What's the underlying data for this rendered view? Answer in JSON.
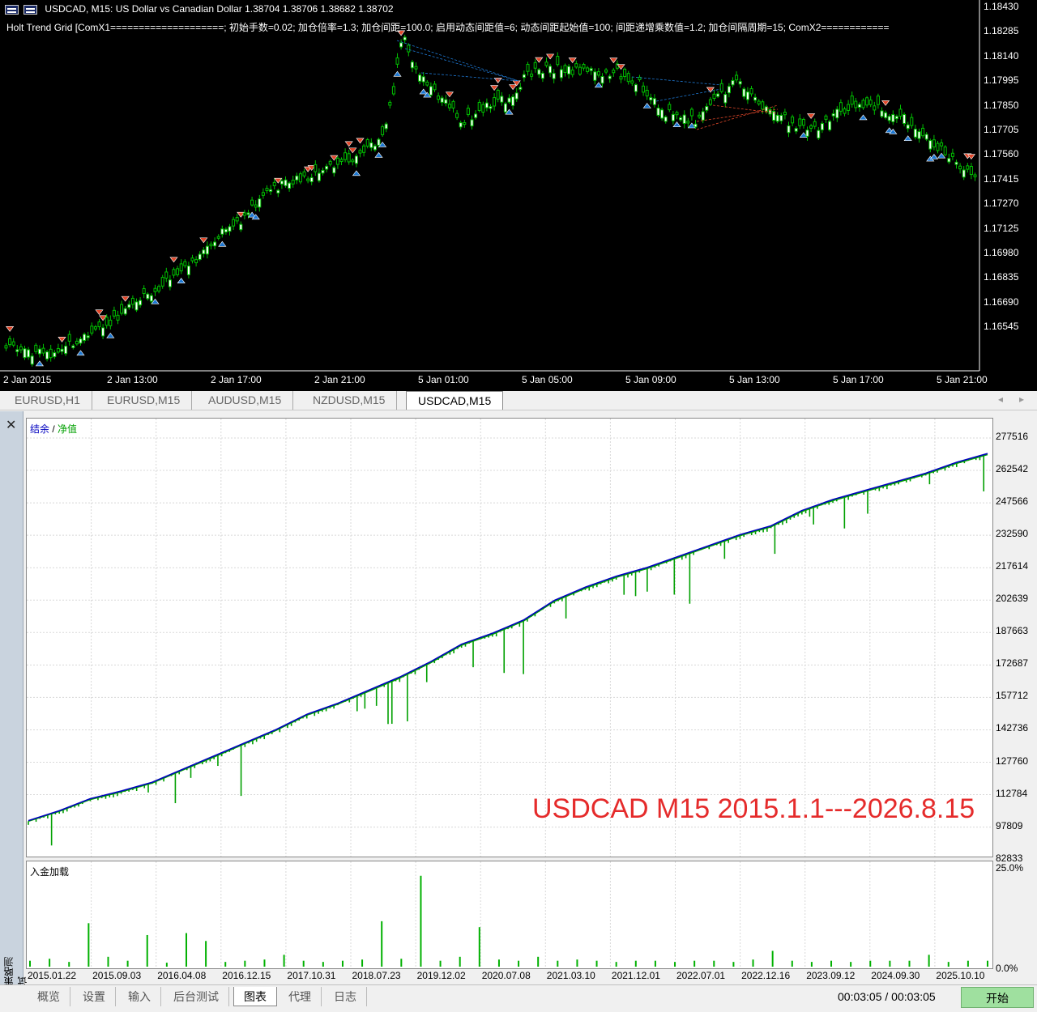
{
  "price_chart": {
    "header": {
      "symbol_line": "USDCAD, M15:  US Dollar vs Canadian Dollar  1.38704 1.38706 1.38682 1.38702",
      "indicator_line": "Holt Trend Grid  [ComX1====================; 初始手数=0.02; 加仓倍率=1.3; 加仓间距=100.0; 启用动态间距值=6; 动态间距起始值=100; 间距递增乘数值=1.2; 加仓间隔周期=15; ComX2============"
    },
    "price_axis": [
      "1.18430",
      "1.18285",
      "1.18140",
      "1.17995",
      "1.17850",
      "1.17705",
      "1.17560",
      "1.17415",
      "1.17270",
      "1.17125",
      "1.16980",
      "1.16835",
      "1.16690",
      "1.16545"
    ],
    "time_axis": [
      "2 Jan 2015",
      "2 Jan 13:00",
      "2 Jan 17:00",
      "2 Jan 21:00",
      "5 Jan 01:00",
      "5 Jan 05:00",
      "5 Jan 09:00",
      "5 Jan 13:00",
      "5 Jan 17:00",
      "5 Jan 21:00"
    ],
    "colors": {
      "background": "#000000",
      "up_candle": "#00c000",
      "down_candle": "#00c000",
      "buy_arrow": "#1e78d2",
      "sell_arrow": "#e0472a"
    }
  },
  "symbol_tabs": [
    "EURUSD,H1",
    "EURUSD,M15",
    "AUDUSD,M15",
    "NZDUSD,M15",
    "USDCAD,M15"
  ],
  "active_symbol_tab": "USDCAD,M15",
  "tester": {
    "side_title": "策略测试",
    "legend_balance": "结余",
    "legend_sep": " / ",
    "legend_equity": "净值",
    "deposit_title": "入金加载",
    "annotation": "USDCAD M15 2015.1.1---2026.8.15",
    "value_axis": [
      "277516",
      "262542",
      "247566",
      "232590",
      "217614",
      "202639",
      "187663",
      "172687",
      "157712",
      "142736",
      "127760",
      "112784",
      "97809",
      "82833"
    ],
    "deposit_axis": [
      "25.0%",
      "0.0%"
    ],
    "dates": [
      "2015.01.22",
      "2015.09.03",
      "2016.04.08",
      "2016.12.15",
      "2017.10.31",
      "2018.07.23",
      "2019.12.02",
      "2020.07.08",
      "2021.03.10",
      "2021.12.01",
      "2022.07.01",
      "2022.12.16",
      "2023.09.12",
      "2024.09.30",
      "2025.10.10"
    ],
    "colors": {
      "balance": "#0000c0",
      "equity": "#00a000",
      "load": "#00b000",
      "annotation": "#e52b2b"
    }
  },
  "chart_data": [
    {
      "type": "line",
      "title": "",
      "series": [
        {
          "name": "结余",
          "values": [
            98500,
            103000,
            108500,
            112000,
            116000,
            122000,
            128000,
            134000,
            140000,
            147000,
            152000,
            158000,
            164000,
            171000,
            179000,
            184000,
            190000,
            199000,
            205000,
            210000,
            214000,
            219000,
            224000,
            229000,
            233000,
            240000,
            245000,
            249000,
            253000,
            257000,
            262000,
            266000
          ]
        },
        {
          "name": "净值",
          "values": [
            98200,
            102700,
            108100,
            111600,
            115600,
            121600,
            127500,
            133600,
            139600,
            146600,
            151600,
            157500,
            163500,
            170500,
            178500,
            183500,
            189500,
            198500,
            204500,
            209500,
            213500,
            218500,
            223500,
            228500,
            232500,
            239500,
            244500,
            248500,
            252500,
            256500,
            261500,
            265500
          ]
        }
      ],
      "x_range": [
        "2015.01.01",
        "2026.08.15"
      ],
      "ylim": [
        82833,
        277516
      ],
      "grid": true
    },
    {
      "type": "bar",
      "title": "入金加载",
      "ylim": [
        0,
        25
      ],
      "values": [
        1.5,
        2,
        1.2,
        11,
        2.5,
        1.5,
        8,
        1,
        8.5,
        6.5,
        1.2,
        1.5,
        1.8,
        3,
        1.5,
        1.2,
        1.5,
        1.8,
        11.5,
        2,
        23,
        1.5,
        2.5,
        10,
        1.8,
        1.5,
        2.5,
        1.5,
        1.8,
        1.5,
        1.2,
        1.5,
        1.5,
        1.2,
        1.5,
        1.5,
        1.2,
        1.8,
        4,
        1.5,
        1.2,
        1.5,
        1.2,
        1.5,
        1.5,
        1.5,
        3,
        1.2,
        1.5,
        1.5
      ]
    }
  ],
  "bottom_tabs": [
    "概览",
    "设置",
    "输入",
    "后台测试",
    "图表",
    "代理",
    "日志"
  ],
  "active_bottom_tab": "图表",
  "elapsed": "00:03:05 / 00:03:05",
  "start_label": "开始"
}
